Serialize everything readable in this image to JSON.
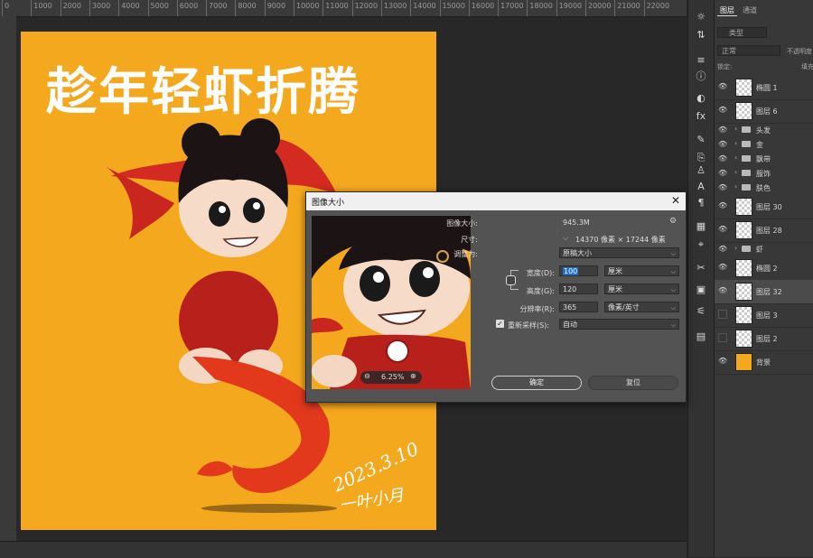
{
  "ruler": {
    "ticks": [
      "0",
      "1000",
      "2000",
      "3000",
      "4000",
      "5000",
      "6000",
      "7000",
      "8000",
      "9000",
      "10000",
      "11000",
      "12000",
      "13000",
      "14000",
      "15000",
      "16000",
      "17000",
      "18000",
      "19000",
      "20000",
      "21000",
      "22000"
    ]
  },
  "artwork": {
    "title_text": "趁年轻虾折腾",
    "signature_line1": "2023.3.10",
    "signature_line2": "一叶小月"
  },
  "tools": [
    "sun-icon",
    "adjust-icon",
    "sliders-icon",
    "info-icon",
    "brush-settings-icon",
    "fx-icon",
    "brush-icon",
    "clone-icon",
    "stamp-icon",
    "text-icon",
    "paragraph-icon",
    "swatch-icon",
    "path-icon",
    "scissors-icon",
    "square-icon",
    "settings-icon",
    "table-icon"
  ],
  "layers_panel": {
    "tabs": [
      "图层",
      "通道"
    ],
    "filter_label": "类型",
    "blend_mode": "正常",
    "opacity_label": "不透明度",
    "lock_label": "锁定:",
    "fill_label": "填充",
    "layers": [
      {
        "name": "椭圆 1",
        "type": "layer"
      },
      {
        "name": "图层 6",
        "type": "layer"
      },
      {
        "name": "头发",
        "type": "group"
      },
      {
        "name": "金",
        "type": "group"
      },
      {
        "name": "飘带",
        "type": "group"
      },
      {
        "name": "服饰",
        "type": "group"
      },
      {
        "name": "肤色",
        "type": "group"
      },
      {
        "name": "图层 30",
        "type": "layer"
      },
      {
        "name": "图层 28",
        "type": "layer"
      },
      {
        "name": "虾",
        "type": "group"
      },
      {
        "name": "椭圆 2",
        "type": "layer"
      },
      {
        "name": "图层 32",
        "type": "layer",
        "selected": true
      },
      {
        "name": "图层 3",
        "type": "layer"
      },
      {
        "name": "图层 2",
        "type": "layer"
      },
      {
        "name": "背景",
        "type": "background"
      }
    ]
  },
  "dialog": {
    "title": "图像大小",
    "image_size_label": "图像大小:",
    "image_size_value": "945.3M",
    "dimensions_label": "尺寸:",
    "dimensions_value": "14370 像素 × 17244 像素",
    "fit_to_label": "调整为:",
    "fit_to_value": "原稿大小",
    "width_label": "宽度(D):",
    "width_value": "100",
    "width_unit": "厘米",
    "height_label": "高度(G):",
    "height_value": "120",
    "height_unit": "厘米",
    "resolution_label": "分辨率(R):",
    "resolution_value": "365",
    "resolution_unit": "像素/英寸",
    "resample_label": "重新采样(S):",
    "resample_value": "自动",
    "zoom_level": "6.25%",
    "ok_label": "确定",
    "reset_label": "复位"
  },
  "colors": {
    "artwork_bg": "#f4a81e",
    "accent_selection": "#1f6fd1",
    "panel_bg": "#383838"
  }
}
